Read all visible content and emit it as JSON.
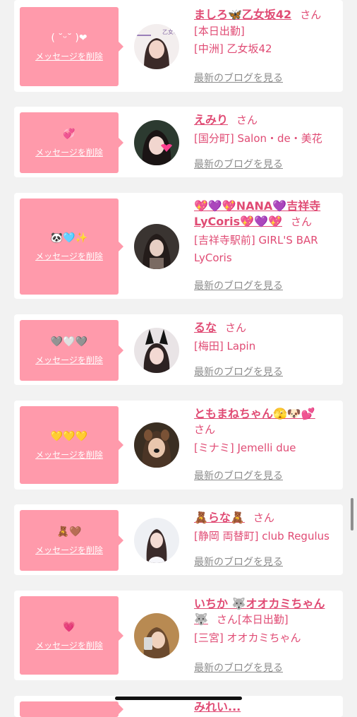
{
  "delete_label": "メッセージを削除",
  "blog_label": "最新のブログを見る",
  "san_label": "さん",
  "colors": {
    "accent": "#e04b74",
    "bubble": "#ff9aab",
    "link_gray": "#8c8c8c"
  },
  "cards": [
    {
      "message": "( ˘ᵕ˘ )❤",
      "name": "ましろ🦋乙女坂42",
      "san": "さん",
      "status": "[本日出勤]",
      "place": "[中洲] 乙女坂42",
      "avatar": "photo-woman",
      "avatar_text": "乙女坂42"
    },
    {
      "message": "💞",
      "name": "えみり",
      "san": "さん",
      "place": "[国分町] Salon・de・美花",
      "avatar": "photo-woman-heart"
    },
    {
      "message": "🐼🩵✨",
      "name": "💖💜💖NANA💜吉祥寺",
      "name2": "LyCoris💖💜💖",
      "san": "さん",
      "place": "[吉祥寺駅前] GIRL'S BAR",
      "place2": "LyCoris",
      "avatar": "photo-woman-dark"
    },
    {
      "message": "🩶🤍🩶",
      "name": "るな",
      "san": "さん",
      "place": "[梅田] Lapin",
      "avatar": "photo-bunny-ears"
    },
    {
      "message": "💛💛💛",
      "name": "ともまねちゃん🫣🐶💕",
      "san": "さん",
      "place": "[ミナミ] Jemelli due",
      "avatar": "photo-dog-filter"
    },
    {
      "message": "🧸🤎",
      "name": "🧸らな🧸",
      "san": "さん",
      "place": "[静岡 両替町] club Regulus",
      "avatar": "photo-woman-light"
    },
    {
      "message": "💗",
      "name": "いちか 🐺オオカミちゃん",
      "name2": "🐺",
      "san": "さん",
      "status": "[本日出勤]",
      "place": "[三宮] オオカミちゃん",
      "avatar": "photo-woman-warm"
    }
  ],
  "partial_card": {
    "name": "みれい..."
  }
}
